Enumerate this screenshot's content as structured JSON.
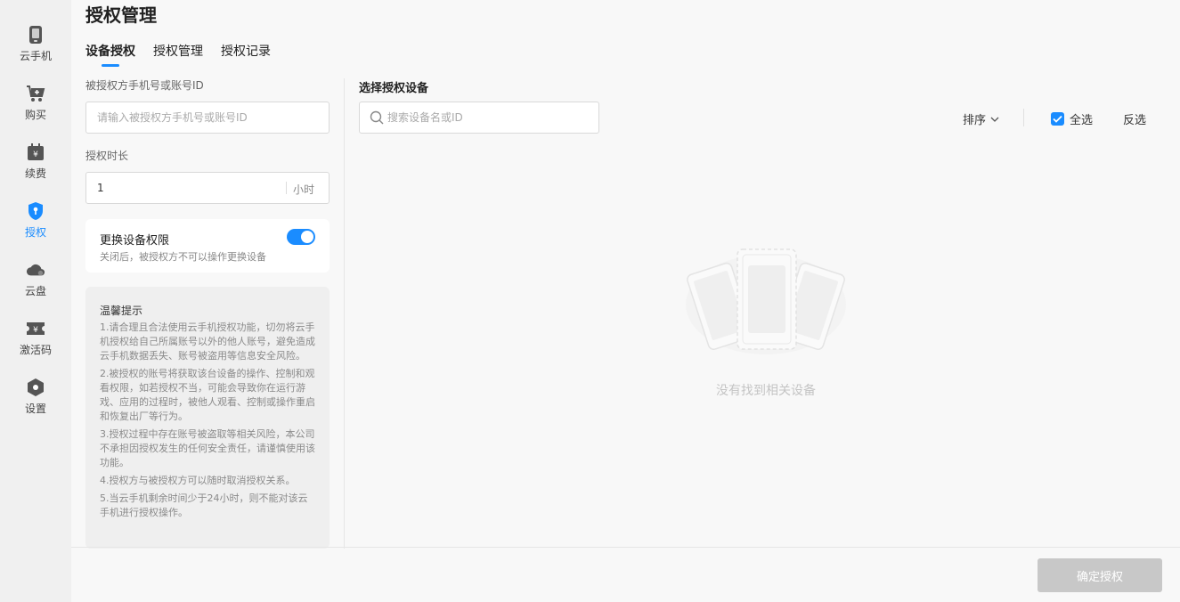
{
  "sidebar": {
    "items": [
      {
        "label": "云手机",
        "icon": "phone-icon"
      },
      {
        "label": "购买",
        "icon": "cart-icon"
      },
      {
        "label": "续费",
        "icon": "renew-icon"
      },
      {
        "label": "授权",
        "icon": "shield-icon",
        "active": true
      },
      {
        "label": "云盘",
        "icon": "cloud-icon"
      },
      {
        "label": "激活码",
        "icon": "ticket-icon"
      },
      {
        "label": "设置",
        "icon": "gear-icon"
      }
    ]
  },
  "page": {
    "title": "授权管理",
    "tabs": [
      {
        "label": "设备授权",
        "active": true
      },
      {
        "label": "授权管理"
      },
      {
        "label": "授权记录"
      }
    ]
  },
  "form": {
    "account_label": "被授权方手机号或账号ID",
    "account_placeholder": "请输入被授权方手机号或账号ID",
    "account_value": "",
    "duration_label": "授权时长",
    "duration_value": "1",
    "duration_unit": "小时",
    "switch_title": "更换设备权限",
    "switch_desc": "关闭后，被授权方不可以操作更换设备",
    "switch_on": true
  },
  "tips": {
    "title": "温馨提示",
    "items": [
      "1.请合理且合法使用云手机授权功能，切勿将云手机授权给自己所属账号以外的他人账号，避免造成云手机数据丢失、账号被盗用等信息安全风险。",
      "2.被授权的账号将获取该台设备的操作、控制和观看权限，如若授权不当，可能会导致你在运行游戏、应用的过程时，被他人观看、控制或操作重启和恢复出厂等行为。",
      "3.授权过程中存在账号被盗取等相关风险，本公司不承担因授权发生的任何安全责任，请谨慎使用该功能。",
      "4.授权方与被授权方可以随时取消授权关系。",
      "5.当云手机剩余时间少于24小时，则不能对该云手机进行授权操作。"
    ]
  },
  "devices": {
    "section_title": "选择授权设备",
    "search_placeholder": "搜索设备名或ID",
    "sort_label": "排序",
    "select_all_label": "全选",
    "select_all_checked": true,
    "invert_label": "反选",
    "empty_text": "没有找到相关设备"
  },
  "footer": {
    "confirm_label": "确定授权"
  },
  "colors": {
    "accent": "#1a8cff",
    "disabled_button": "#c8c8c8"
  }
}
